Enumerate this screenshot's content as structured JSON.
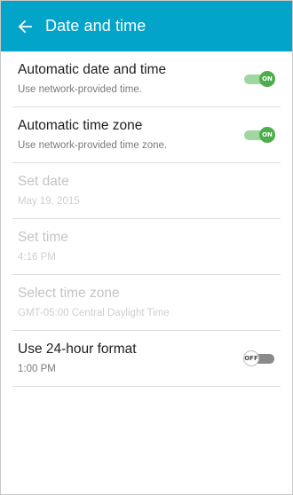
{
  "colors": {
    "appbar": "#03a4c9",
    "switch_on": "#4cae4c",
    "switch_on_track": "#8fcf8f",
    "switch_off_track": "#8a8a8a"
  },
  "header": {
    "back_icon": "arrow-left-icon",
    "title": "Date and time"
  },
  "settings": [
    {
      "id": "automatic-date-and-time",
      "title": "Automatic date and time",
      "subtitle": "Use network-provided time.",
      "enabled": true,
      "toggle": "on",
      "toggle_label": "ON"
    },
    {
      "id": "automatic-time-zone",
      "title": "Automatic time zone",
      "subtitle": "Use network-provided time zone.",
      "enabled": true,
      "toggle": "on",
      "toggle_label": "ON"
    },
    {
      "id": "set-date",
      "title": "Set date",
      "subtitle": "May 19, 2015",
      "enabled": false
    },
    {
      "id": "set-time",
      "title": "Set time",
      "subtitle": "4:16 PM",
      "enabled": false
    },
    {
      "id": "select-time-zone",
      "title": "Select time zone",
      "subtitle": "GMT-05:00 Central Daylight Time",
      "enabled": false
    },
    {
      "id": "use-24-hour-format",
      "title": "Use 24-hour format",
      "subtitle": "1:00 PM",
      "enabled": true,
      "toggle": "off",
      "toggle_label": "OFF"
    }
  ]
}
